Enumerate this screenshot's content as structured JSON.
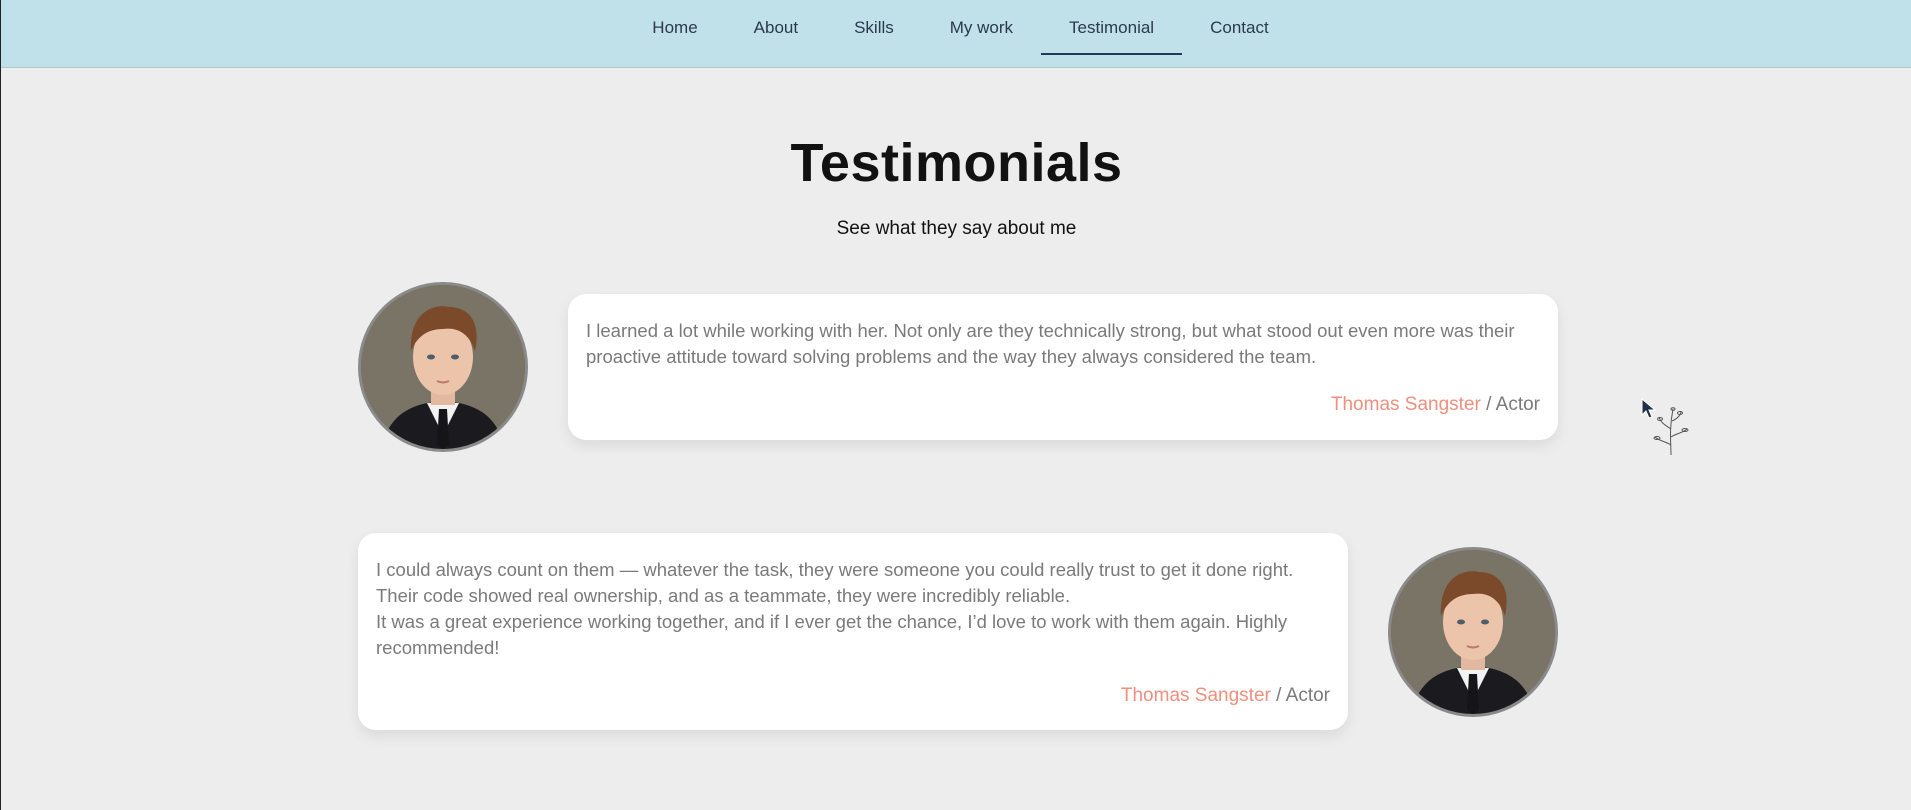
{
  "nav": {
    "items": [
      {
        "label": "Home"
      },
      {
        "label": "About"
      },
      {
        "label": "Skills"
      },
      {
        "label": "My work"
      },
      {
        "label": "Testimonial"
      },
      {
        "label": "Contact"
      }
    ],
    "active_index": 4
  },
  "header": {
    "title": "Testimonials",
    "subtitle": "See what they say about me"
  },
  "testimonials": [
    {
      "lines": [
        "I learned a lot while working with her. Not only are they technically strong, but what stood out even more was their",
        "proactive attitude toward solving problems and the way they always considered the team."
      ],
      "name": "Thomas Sangster",
      "separator": " / ",
      "role": "Actor"
    },
    {
      "lines": [
        "I could always count on them — whatever the task, they were someone you could really trust to get it done right.",
        "Their code showed real ownership, and as a teammate, they were incredibly reliable.",
        "It was a great experience working together, and if I ever get the chance, I’d love to work with them again. Highly",
        "recommended!"
      ],
      "name": "Thomas Sangster",
      "separator": " / ",
      "role": "Actor"
    }
  ],
  "colors": {
    "nav_bg": "#c0e1ea",
    "page_bg": "#ededed",
    "accent_name": "#ef8f7e",
    "text_muted": "#7a7a7a",
    "nav_active_underline": "#1f3b57"
  },
  "icons": {
    "cursor": "mouse-pointer-icon",
    "decoration": "plant-sprig-icon"
  }
}
